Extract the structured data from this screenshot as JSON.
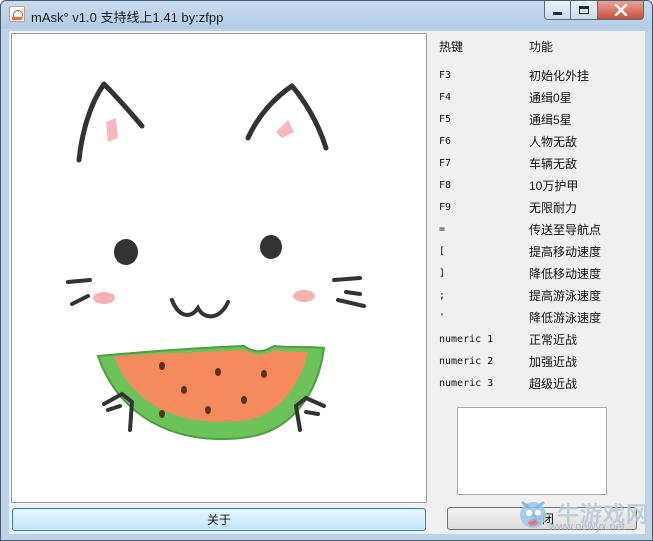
{
  "window": {
    "title": "mAsk° v1.0 支持线上1.41 by:zfpp"
  },
  "hotkeys": {
    "header_key": "热键",
    "header_fn": "功能",
    "rows": [
      {
        "key": "F3",
        "fn": "初始化外挂"
      },
      {
        "key": "F4",
        "fn": "通缉0星"
      },
      {
        "key": "F5",
        "fn": "通缉5星"
      },
      {
        "key": "F6",
        "fn": "人物无敌"
      },
      {
        "key": "F7",
        "fn": "车辆无敌"
      },
      {
        "key": "F8",
        "fn": "10万护甲"
      },
      {
        "key": "F9",
        "fn": "无限耐力"
      },
      {
        "key": "=",
        "fn": "传送至导航点"
      },
      {
        "key": "[",
        "fn": "提高移动速度"
      },
      {
        "key": "]",
        "fn": "降低移动速度"
      },
      {
        "key": ";",
        "fn": "提高游泳速度"
      },
      {
        "key": "'",
        "fn": "降低游泳速度"
      },
      {
        "key": "numeric 1",
        "fn": "正常近战"
      },
      {
        "key": "numeric 2",
        "fn": "加强近战"
      },
      {
        "key": "numeric 3",
        "fn": "超级近战"
      }
    ]
  },
  "buttons": {
    "about": "关于",
    "close": "关闭"
  },
  "watermark": {
    "text": "牛游戏网",
    "url": "www.newyx.net"
  },
  "colors": {
    "titlebar": "#bcd3ea",
    "close_button": "#c74f3c",
    "watermelon_flesh": "#f58a5c",
    "watermelon_rind": "#6cc35a"
  }
}
